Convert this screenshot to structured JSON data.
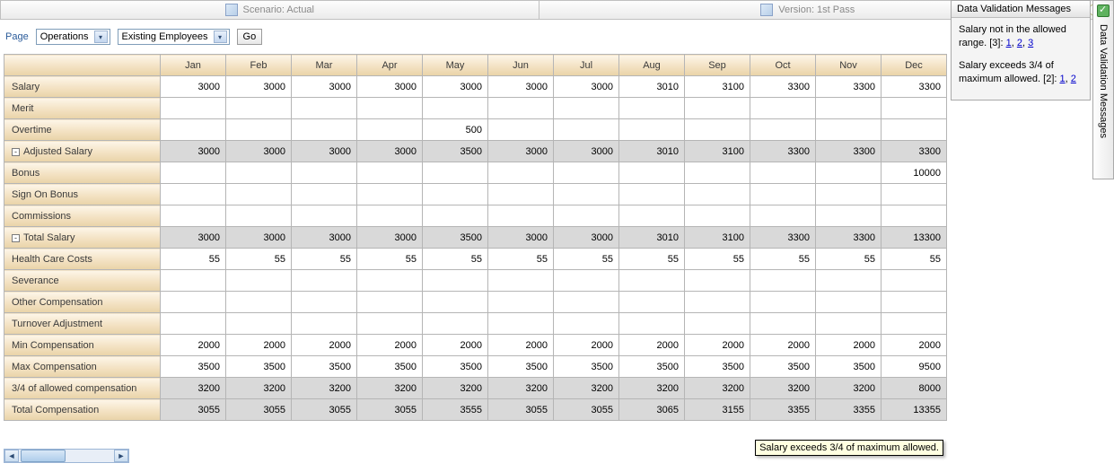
{
  "top": {
    "scenario": "Scenario: Actual",
    "version": "Version: 1st Pass"
  },
  "page": {
    "label": "Page",
    "dim1": "Operations",
    "dim2": "Existing Employees",
    "go": "Go"
  },
  "months": [
    "Jan",
    "Feb",
    "Mar",
    "Apr",
    "May",
    "Jun",
    "Jul",
    "Aug",
    "Sep",
    "Oct",
    "Nov",
    "Dec"
  ],
  "rows": [
    {
      "label": "Salary",
      "vals": [
        "3000",
        "3000",
        "3000",
        "3000",
        "3000",
        "3000",
        "3000",
        "3010",
        "3100",
        "3300",
        "3300",
        "3300"
      ]
    },
    {
      "label": "Merit",
      "vals": [
        "",
        "",
        "",
        "",
        "",
        "",
        "",
        "",
        "",
        "",
        "",
        ""
      ]
    },
    {
      "label": "Overtime",
      "vals": [
        "",
        "",
        "",
        "",
        "500",
        "",
        "",
        "",
        "",
        "",
        "",
        ""
      ]
    },
    {
      "label": "Adjusted Salary",
      "tree": "-",
      "shaded": true,
      "vals": [
        "3000",
        "3000",
        "3000",
        "3000",
        "3500",
        "3000",
        "3000",
        "3010",
        "3100",
        "3300",
        "3300",
        "3300"
      ]
    },
    {
      "label": "Bonus",
      "vals": [
        "",
        "",
        "",
        "",
        "",
        "",
        "",
        "",
        "",
        "",
        "",
        "10000"
      ]
    },
    {
      "label": "Sign On Bonus",
      "vals": [
        "",
        "",
        "",
        "",
        "",
        "",
        "",
        "",
        "",
        "",
        "",
        ""
      ]
    },
    {
      "label": "Commissions",
      "vals": [
        "",
        "",
        "",
        "",
        "",
        "",
        "",
        "",
        "",
        "",
        "",
        ""
      ]
    },
    {
      "label": "Total Salary",
      "tree": "-",
      "shaded": true,
      "vals": [
        "3000",
        "3000",
        "3000",
        "3000",
        "3500",
        "3000",
        "3000",
        "3010",
        "3100",
        "3300",
        "3300",
        "13300"
      ]
    },
    {
      "label": "Health Care Costs",
      "vals": [
        "55",
        "55",
        "55",
        "55",
        "55",
        "55",
        "55",
        "55",
        "55",
        "55",
        "55",
        "55"
      ]
    },
    {
      "label": "Severance",
      "vals": [
        "",
        "",
        "",
        "",
        "",
        "",
        "",
        "",
        "",
        "",
        "",
        ""
      ]
    },
    {
      "label": "Other Compensation",
      "vals": [
        "",
        "",
        "",
        "",
        "",
        "",
        "",
        "",
        "",
        "",
        "",
        ""
      ]
    },
    {
      "label": "Turnover Adjustment",
      "vals": [
        "",
        "",
        "",
        "",
        "",
        "",
        "",
        "",
        "",
        "",
        "",
        ""
      ]
    },
    {
      "label": "Min Compensation",
      "vals": [
        "2000",
        "2000",
        "2000",
        "2000",
        "2000",
        "2000",
        "2000",
        "2000",
        "2000",
        "2000",
        "2000",
        "2000"
      ]
    },
    {
      "label": "Max Compensation",
      "vals": [
        "3500",
        "3500",
        "3500",
        "3500",
        "3500",
        "3500",
        "3500",
        "3500",
        "3500",
        "3500",
        "3500",
        "9500"
      ]
    },
    {
      "label": "3/4 of allowed compensation",
      "shaded": true,
      "vals": [
        "3200",
        "3200",
        "3200",
        "3200",
        "3200",
        "3200",
        "3200",
        "3200",
        "3200",
        "3200",
        "3200",
        "8000"
      ]
    },
    {
      "label": "Total Compensation",
      "shaded": true,
      "vals": [
        "3055",
        "3055",
        "3055",
        "3055",
        "3555",
        "3055",
        "3055",
        "3065",
        "3155",
        "3355",
        "3355",
        "13355"
      ],
      "flags": [
        "",
        "",
        "",
        "",
        "red",
        "",
        "",
        "",
        "",
        "yellow",
        "yellow",
        "red"
      ],
      "stubflag": "red"
    }
  ],
  "tooltip": "Salary exceeds 3/4 of maximum allowed.",
  "panel": {
    "title": "Data Validation Messages",
    "msg1_text": "Salary not in the allowed range. [3]: ",
    "msg1_links": [
      "1",
      "2",
      "3"
    ],
    "msg2_text": "Salary exceeds 3/4 of maximum allowed. [2]: ",
    "msg2_links": [
      "1",
      "2"
    ]
  },
  "sidetab": "Data Validation Messages"
}
